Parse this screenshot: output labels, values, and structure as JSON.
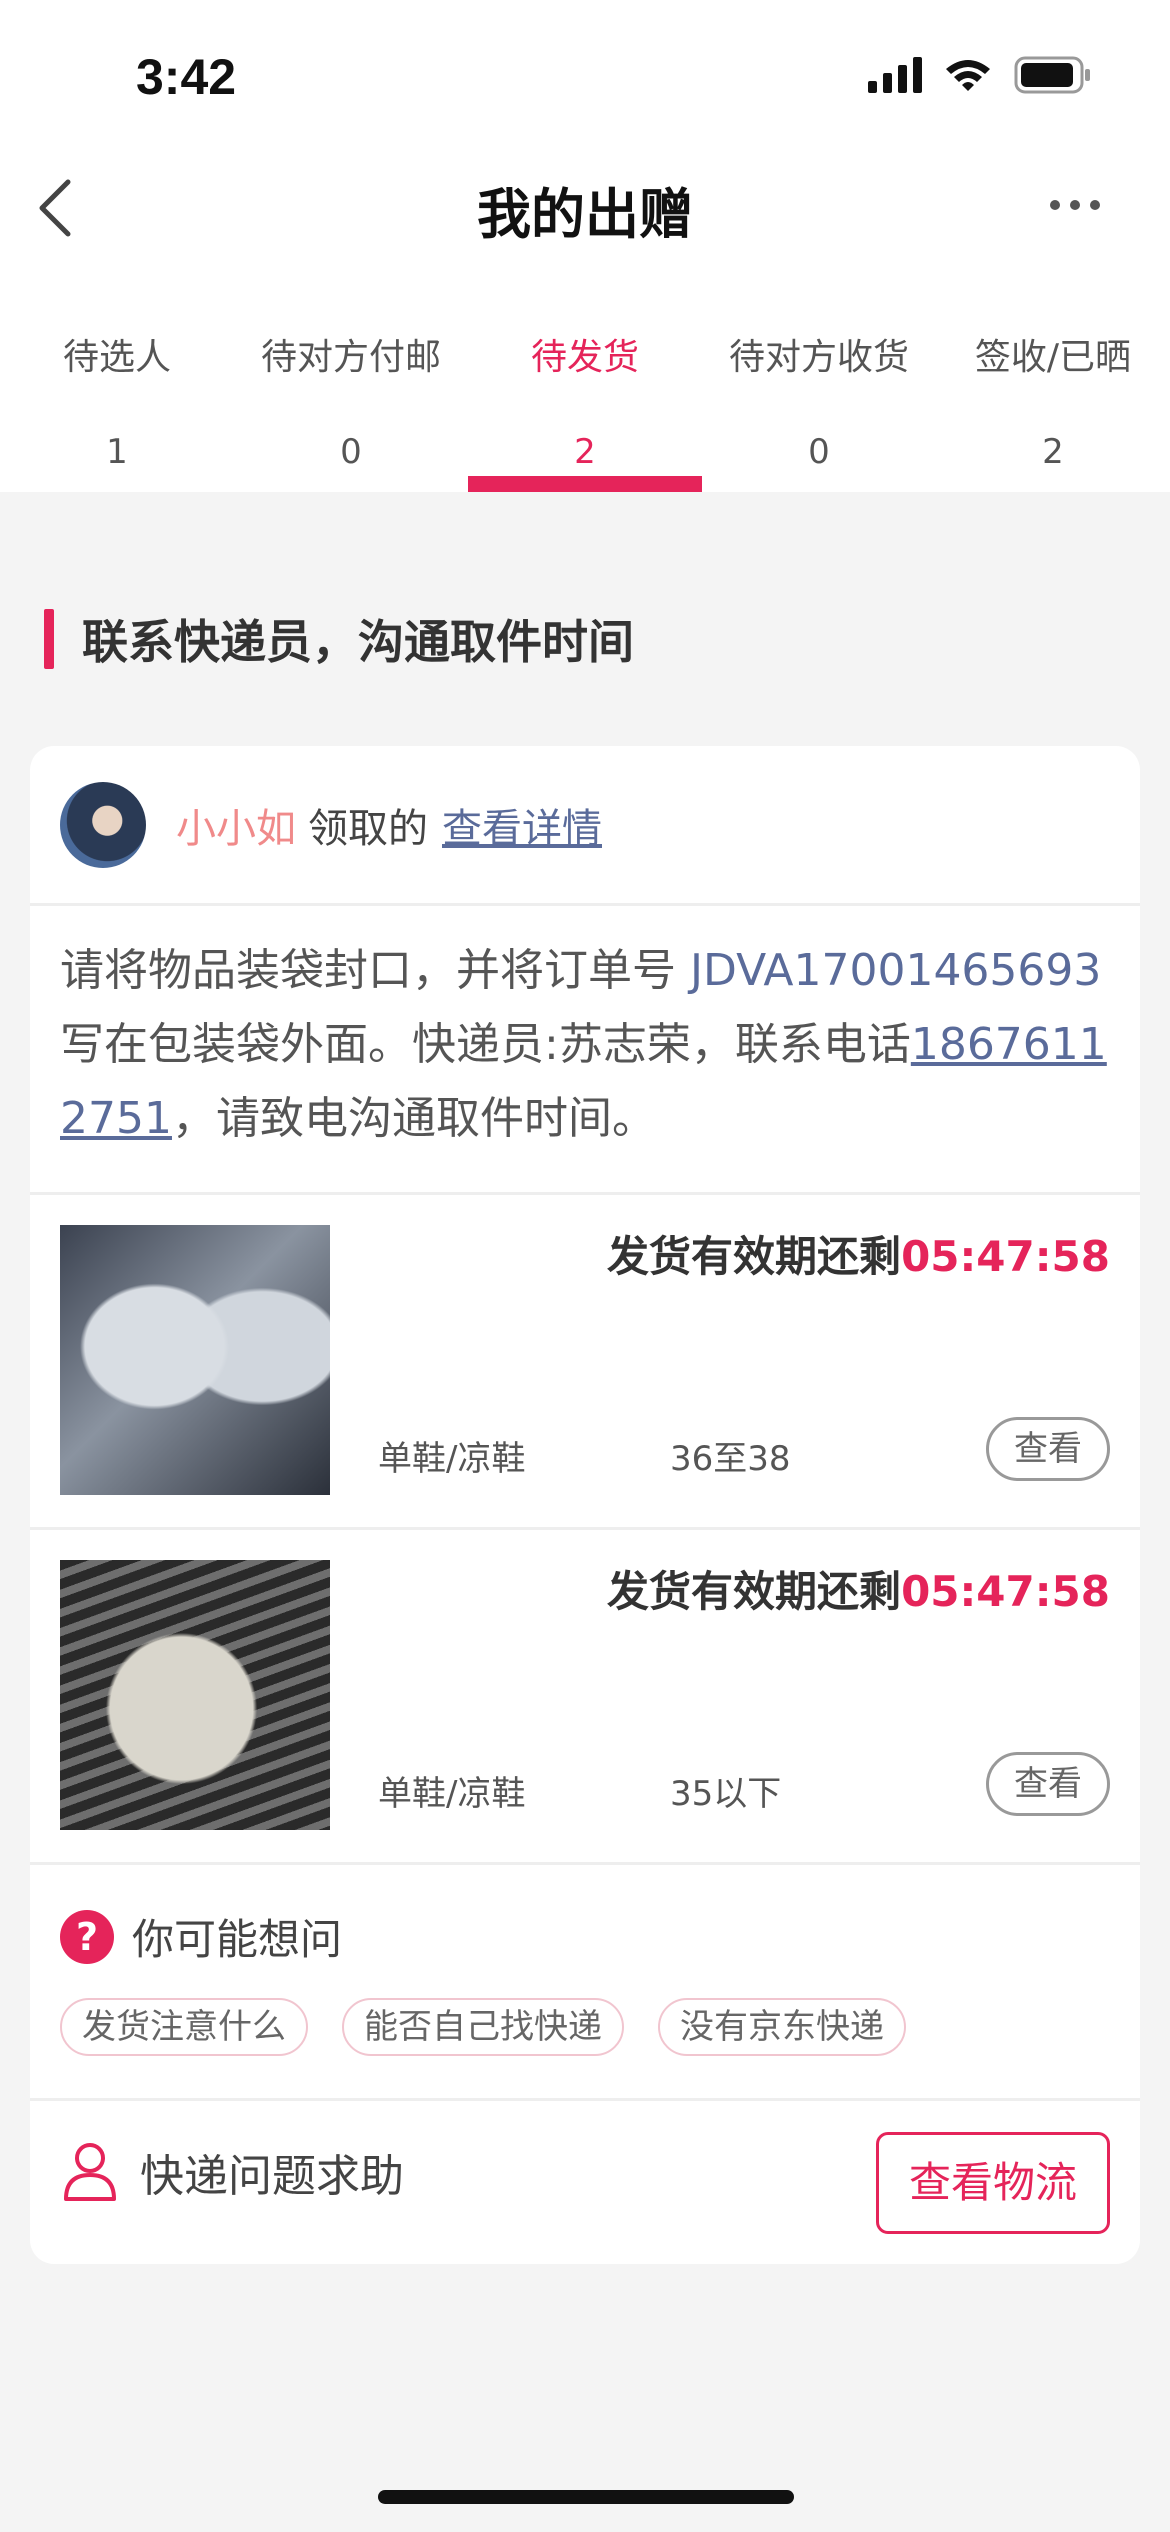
{
  "status_bar": {
    "time": "3:42"
  },
  "nav": {
    "title": "我的出赠"
  },
  "tabs": [
    {
      "label": "待选人",
      "count": "1"
    },
    {
      "label": "待对方付邮",
      "count": "0"
    },
    {
      "label": "待发货",
      "count": "2",
      "active": true
    },
    {
      "label": "待对方收货",
      "count": "0"
    },
    {
      "label": "签收/已晒",
      "count": "2"
    }
  ],
  "section": {
    "title": "联系快递员，沟通取件时间"
  },
  "receiver": {
    "name": "小小如",
    "text": "领取的",
    "link": "查看详情"
  },
  "instructions": {
    "part1": "请将物品装袋封口，并将订单号 ",
    "order_no": "JDVA17001465693",
    "part2": " 写在包装袋外面。快递员:苏志荣，联系电话",
    "phone": "18676112751",
    "part3": "，请致电沟通取件时间。"
  },
  "items": [
    {
      "deadline_label": "发货有效期还剩",
      "deadline_time": "05:47:58",
      "category": "单鞋/凉鞋",
      "size": "36至38",
      "view_label": "查看"
    },
    {
      "deadline_label": "发货有效期还剩",
      "deadline_time": "05:47:58",
      "category": "单鞋/凉鞋",
      "size": "35以下",
      "view_label": "查看"
    }
  ],
  "faq": {
    "icon": "?",
    "title": "你可能想问",
    "chips": [
      "发货注意什么",
      "能否自己找快递",
      "没有京东快递"
    ]
  },
  "bottom": {
    "help_label": "快递问题求助",
    "logistics_button": "查看物流"
  },
  "colors": {
    "accent": "#e5245a",
    "link": "#5a6b9a",
    "background": "#f4f4f4"
  }
}
